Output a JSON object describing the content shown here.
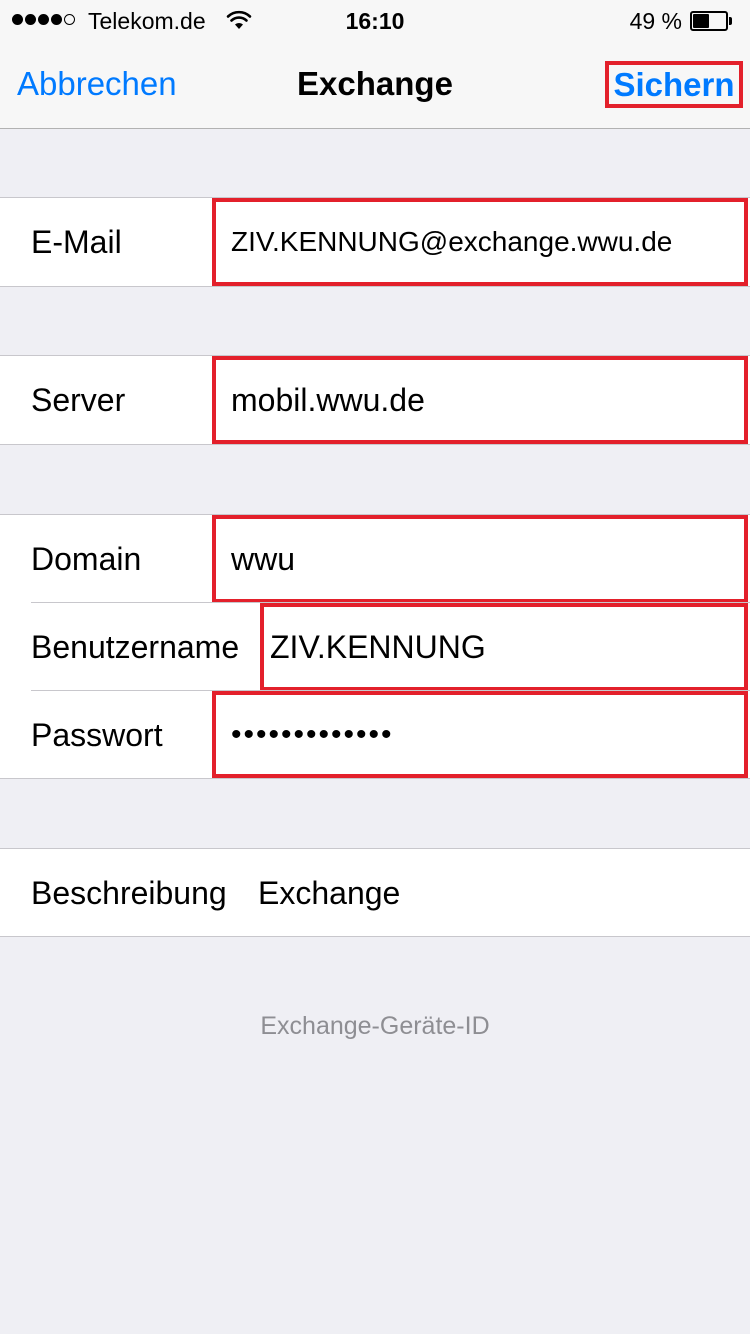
{
  "status_bar": {
    "carrier": "Telekom.de",
    "time": "16:10",
    "battery_percent": "49 %",
    "signal_dots_filled": 4,
    "signal_dots_total": 5,
    "wifi_icon": "wifi-icon",
    "battery_icon": "battery-icon"
  },
  "nav": {
    "cancel_label": "Abbrechen",
    "title": "Exchange",
    "save_label": "Sichern"
  },
  "form": {
    "email": {
      "label": "E-Mail",
      "value": "ZIV.KENNUNG@exchange.wwu.de"
    },
    "server": {
      "label": "Server",
      "value": "mobil.wwu.de"
    },
    "domain": {
      "label": "Domain",
      "value": "wwu"
    },
    "username": {
      "label": "Benutzername",
      "value": "ZIV.KENNUNG"
    },
    "password": {
      "label": "Passwort",
      "value": "•••••••••••••"
    },
    "description": {
      "label": "Beschreibung",
      "value": "Exchange"
    }
  },
  "footer": {
    "device_id_label": "Exchange-Geräte-ID"
  },
  "colors": {
    "accent": "#007aff",
    "highlight": "#e3202b",
    "background": "#efeff4",
    "separator": "#c8c7cc",
    "secondary_text": "#8e8e93"
  }
}
